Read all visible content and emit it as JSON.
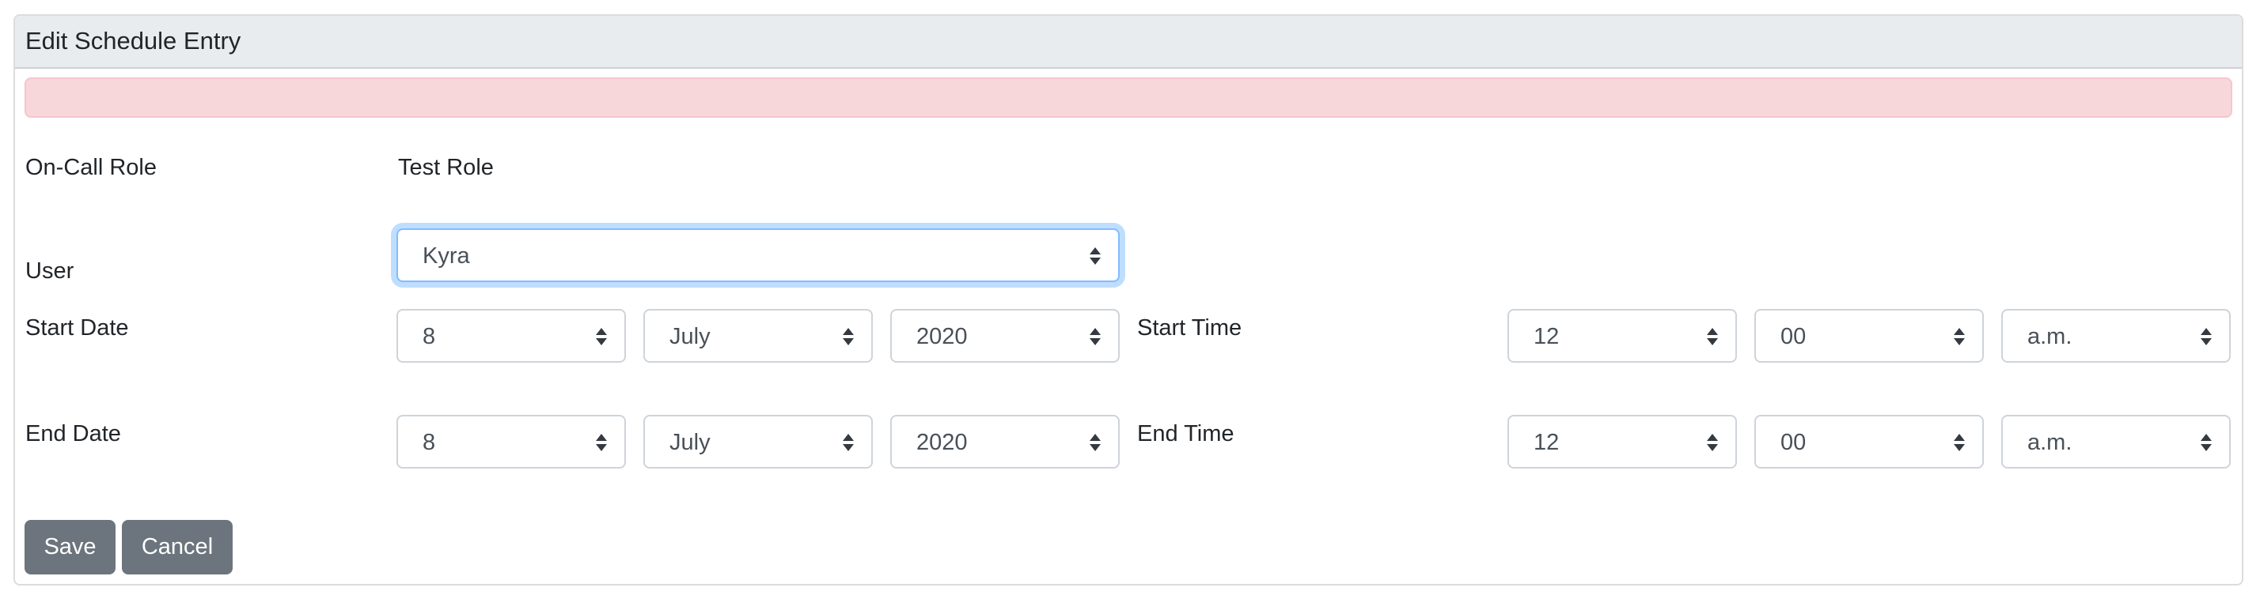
{
  "card": {
    "title": "Edit Schedule Entry",
    "alert_text": ""
  },
  "form": {
    "on_call_role": {
      "label": "On-Call Role",
      "value": "Test Role"
    },
    "user": {
      "label": "User",
      "selected": "Kyra",
      "focused": true
    },
    "start": {
      "date_label": "Start Date",
      "day": "8",
      "month": "July",
      "year": "2020",
      "time_label": "Start Time",
      "hour": "12",
      "minute": "00",
      "meridiem": "a.m."
    },
    "end": {
      "date_label": "End Date",
      "day": "8",
      "month": "July",
      "year": "2020",
      "time_label": "End Time",
      "hour": "12",
      "minute": "00",
      "meridiem": "a.m."
    }
  },
  "actions": {
    "save_label": "Save",
    "cancel_label": "Cancel"
  },
  "colors": {
    "header_bg": "#e9ecef",
    "alert_bg": "#f8d7da",
    "alert_border": "#f5c6cb",
    "focus_border": "#80bdff",
    "button_bg": "#6c757d"
  },
  "icons": {
    "select_arrow": "up-down-caret-icon"
  }
}
